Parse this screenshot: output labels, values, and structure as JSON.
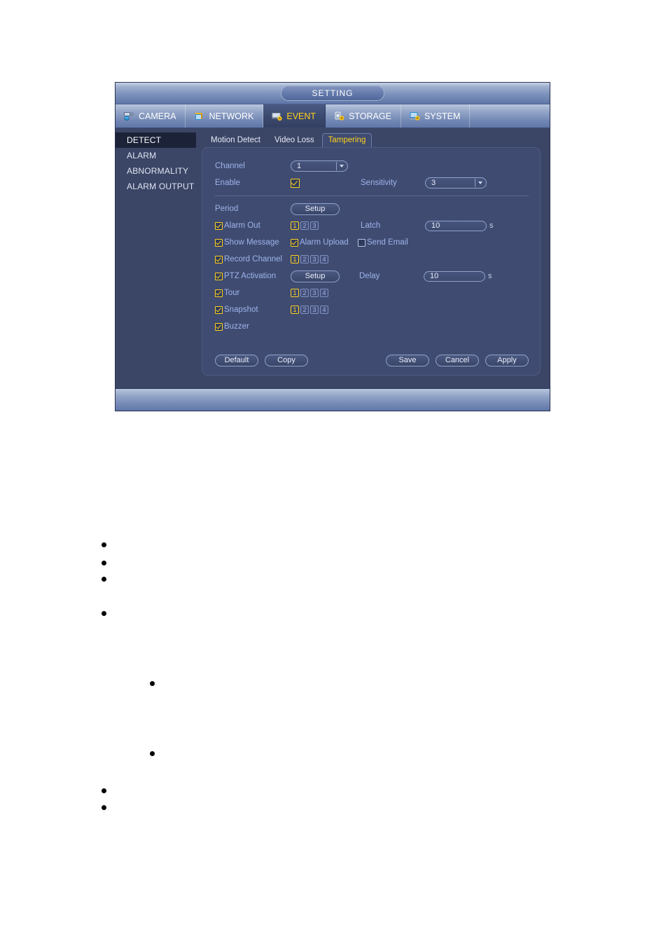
{
  "window": {
    "title": "SETTING",
    "nav": [
      {
        "label": "CAMERA",
        "icon": "camera-icon",
        "active": false
      },
      {
        "label": "NETWORK",
        "icon": "network-icon",
        "active": false
      },
      {
        "label": "EVENT",
        "icon": "event-icon",
        "active": true
      },
      {
        "label": "STORAGE",
        "icon": "storage-icon",
        "active": false
      },
      {
        "label": "SYSTEM",
        "icon": "system-icon",
        "active": false
      }
    ],
    "sidebar": {
      "items": [
        {
          "label": "DETECT",
          "active": true
        },
        {
          "label": "ALARM",
          "active": false
        },
        {
          "label": "ABNORMALITY",
          "active": false
        },
        {
          "label": "ALARM OUTPUT",
          "active": false
        }
      ]
    },
    "subtabs": [
      {
        "label": "Motion Detect",
        "active": false
      },
      {
        "label": "Video Loss",
        "active": false
      },
      {
        "label": "Tampering",
        "active": true
      }
    ],
    "form": {
      "channel_label": "Channel",
      "channel_value": "1",
      "enable_label": "Enable",
      "enable_checked": true,
      "sensitivity_label": "Sensitivity",
      "sensitivity_value": "3",
      "period_label": "Period",
      "period_button": "Setup",
      "alarm_out_label": "Alarm Out",
      "alarm_out_checked": true,
      "alarm_out_channels": [
        {
          "label": "1",
          "on": true
        },
        {
          "label": "2",
          "on": false
        },
        {
          "label": "3",
          "on": false
        }
      ],
      "latch_label": "Latch",
      "latch_value": "10",
      "latch_unit": "s",
      "show_message_label": "Show Message",
      "show_message_checked": true,
      "alarm_upload_label": "Alarm Upload",
      "alarm_upload_checked": true,
      "send_email_label": "Send Email",
      "send_email_checked": false,
      "record_channel_label": "Record Channel",
      "record_channel_checked": true,
      "record_channels": [
        {
          "label": "1",
          "on": true
        },
        {
          "label": "2",
          "on": false
        },
        {
          "label": "3",
          "on": false
        },
        {
          "label": "4",
          "on": false
        }
      ],
      "ptz_activation_label": "PTZ Activation",
      "ptz_activation_checked": true,
      "ptz_button": "Setup",
      "delay_label": "Delay",
      "delay_value": "10",
      "delay_unit": "s",
      "tour_label": "Tour",
      "tour_checked": true,
      "tour_channels": [
        {
          "label": "1",
          "on": true
        },
        {
          "label": "2",
          "on": false
        },
        {
          "label": "3",
          "on": false
        },
        {
          "label": "4",
          "on": false
        }
      ],
      "snapshot_label": "Snapshot",
      "snapshot_checked": true,
      "snapshot_channels": [
        {
          "label": "1",
          "on": true
        },
        {
          "label": "2",
          "on": false
        },
        {
          "label": "3",
          "on": false
        },
        {
          "label": "4",
          "on": false
        }
      ],
      "buzzer_label": "Buzzer",
      "buzzer_checked": true
    },
    "footer": {
      "default_button": "Default",
      "copy_button": "Copy",
      "save_button": "Save",
      "cancel_button": "Cancel",
      "apply_button": "Apply"
    }
  },
  "colors": {
    "accent_yellow": "#ffd21e",
    "panel_bg": "#3f4b70",
    "window_bg": "#3b4566",
    "label_blue": "#9db4ec",
    "sidebar_active_bg": "#1c2338"
  },
  "document": {
    "bullets": [
      {
        "level": 1,
        "text": ""
      },
      {
        "level": 1,
        "text": ""
      },
      {
        "level": 1,
        "text": ""
      },
      {
        "level": 1,
        "text": ""
      },
      {
        "level": 2,
        "text": ""
      },
      {
        "level": 2,
        "text": ""
      },
      {
        "level": 1,
        "text": ""
      },
      {
        "level": 1,
        "text": ""
      }
    ]
  }
}
